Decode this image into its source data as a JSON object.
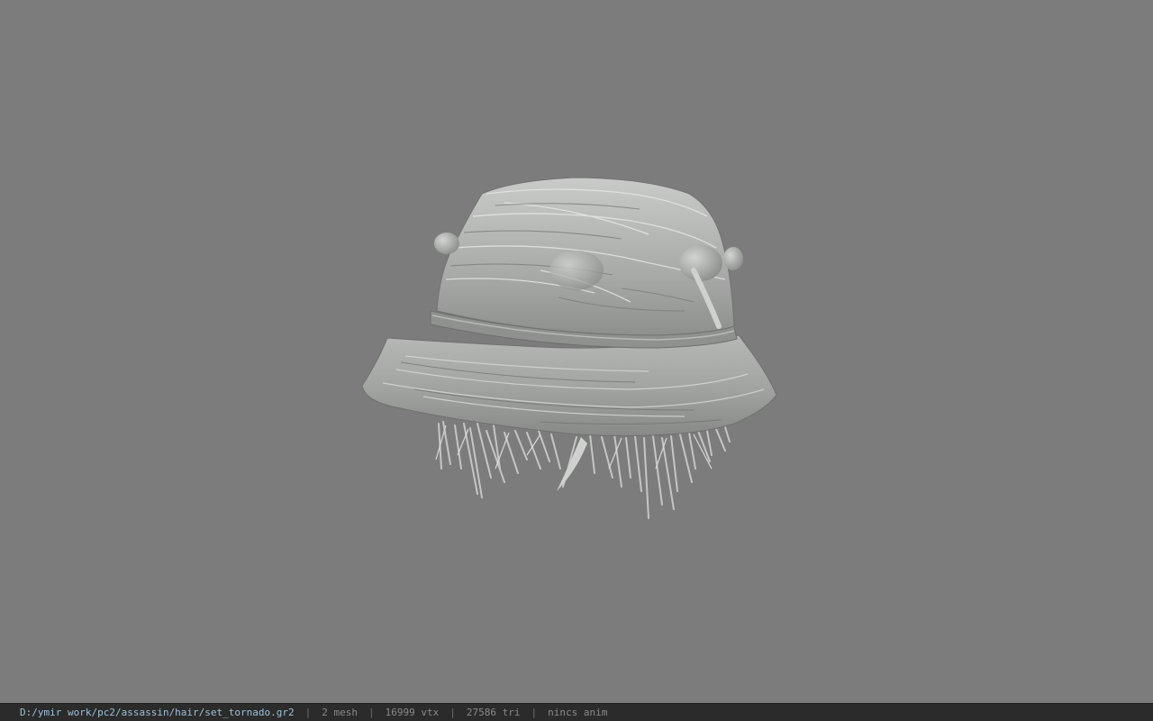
{
  "viewport": {
    "background": "#7c7c7c",
    "model_name": "set_tornado.gr2"
  },
  "statusbar": {
    "file_path": "D:/ymir work/pc2/assassin/hair/set_tornado.gr2",
    "separator": "|",
    "mesh_count": "2 mesh",
    "vertex_count": "16999 vtx",
    "triangle_count": "27586 tri",
    "anim_status": "nincs anim"
  }
}
